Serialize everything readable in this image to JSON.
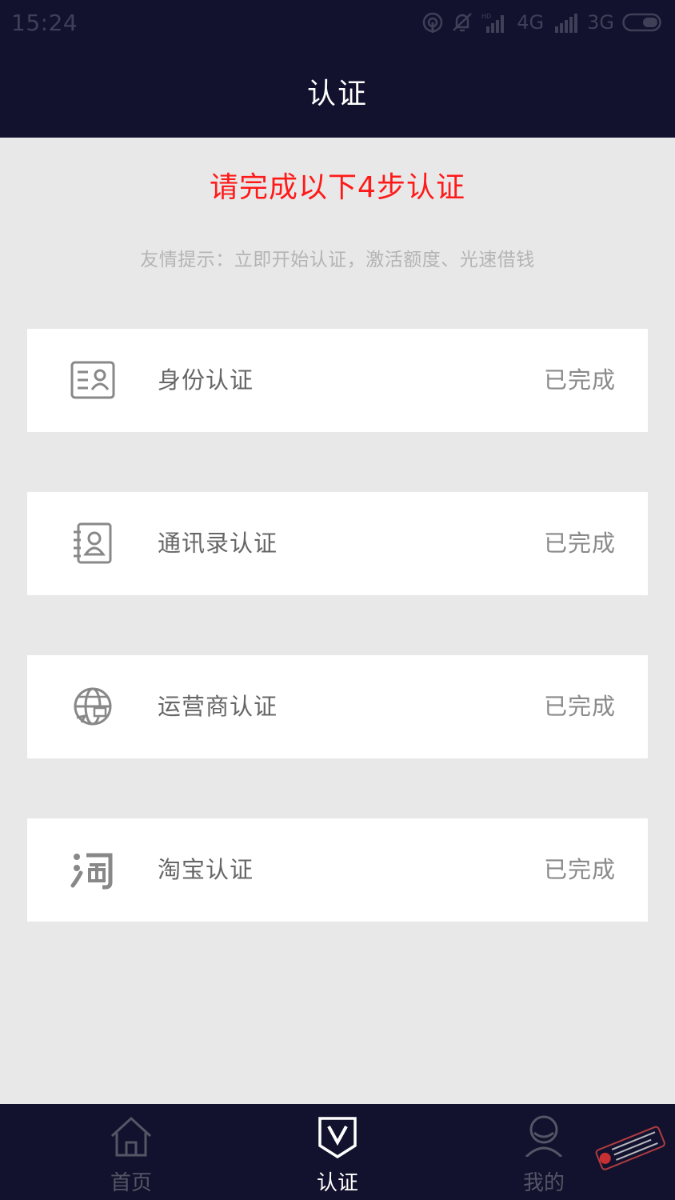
{
  "status_bar": {
    "time": "15:24",
    "network1": "4G",
    "network2": "3G",
    "icons": [
      "hotspot-icon",
      "mute-icon",
      "signal-icon",
      "signal-icon",
      "battery-icon"
    ]
  },
  "header": {
    "title": "认证"
  },
  "intro": {
    "heading": "请完成以下4步认证",
    "tip": "友情提示：立即开始认证，激活额度、光速借钱"
  },
  "steps": [
    {
      "label": "身份认证",
      "status": "已完成",
      "icon": "id-card-icon"
    },
    {
      "label": " 通讯录认证",
      "status": "已完成",
      "icon": "contacts-icon"
    },
    {
      "label": "运营商认证",
      "status": "已完成",
      "icon": "operator-globe-icon"
    },
    {
      "label": "淘宝认证",
      "status": "已完成",
      "icon": "taobao-icon"
    }
  ],
  "tabbar": {
    "tabs": [
      {
        "label": "首页",
        "icon": "home-icon",
        "active": false
      },
      {
        "label": "认证",
        "icon": "shield-v-icon",
        "active": true
      },
      {
        "label": "我的",
        "icon": "user-icon",
        "active": false
      }
    ]
  },
  "colors": {
    "nav_bg": "#12122e",
    "heading_red": "#ff1a1a",
    "page_bg": "#e8e8e8",
    "card_bg": "#ffffff"
  }
}
